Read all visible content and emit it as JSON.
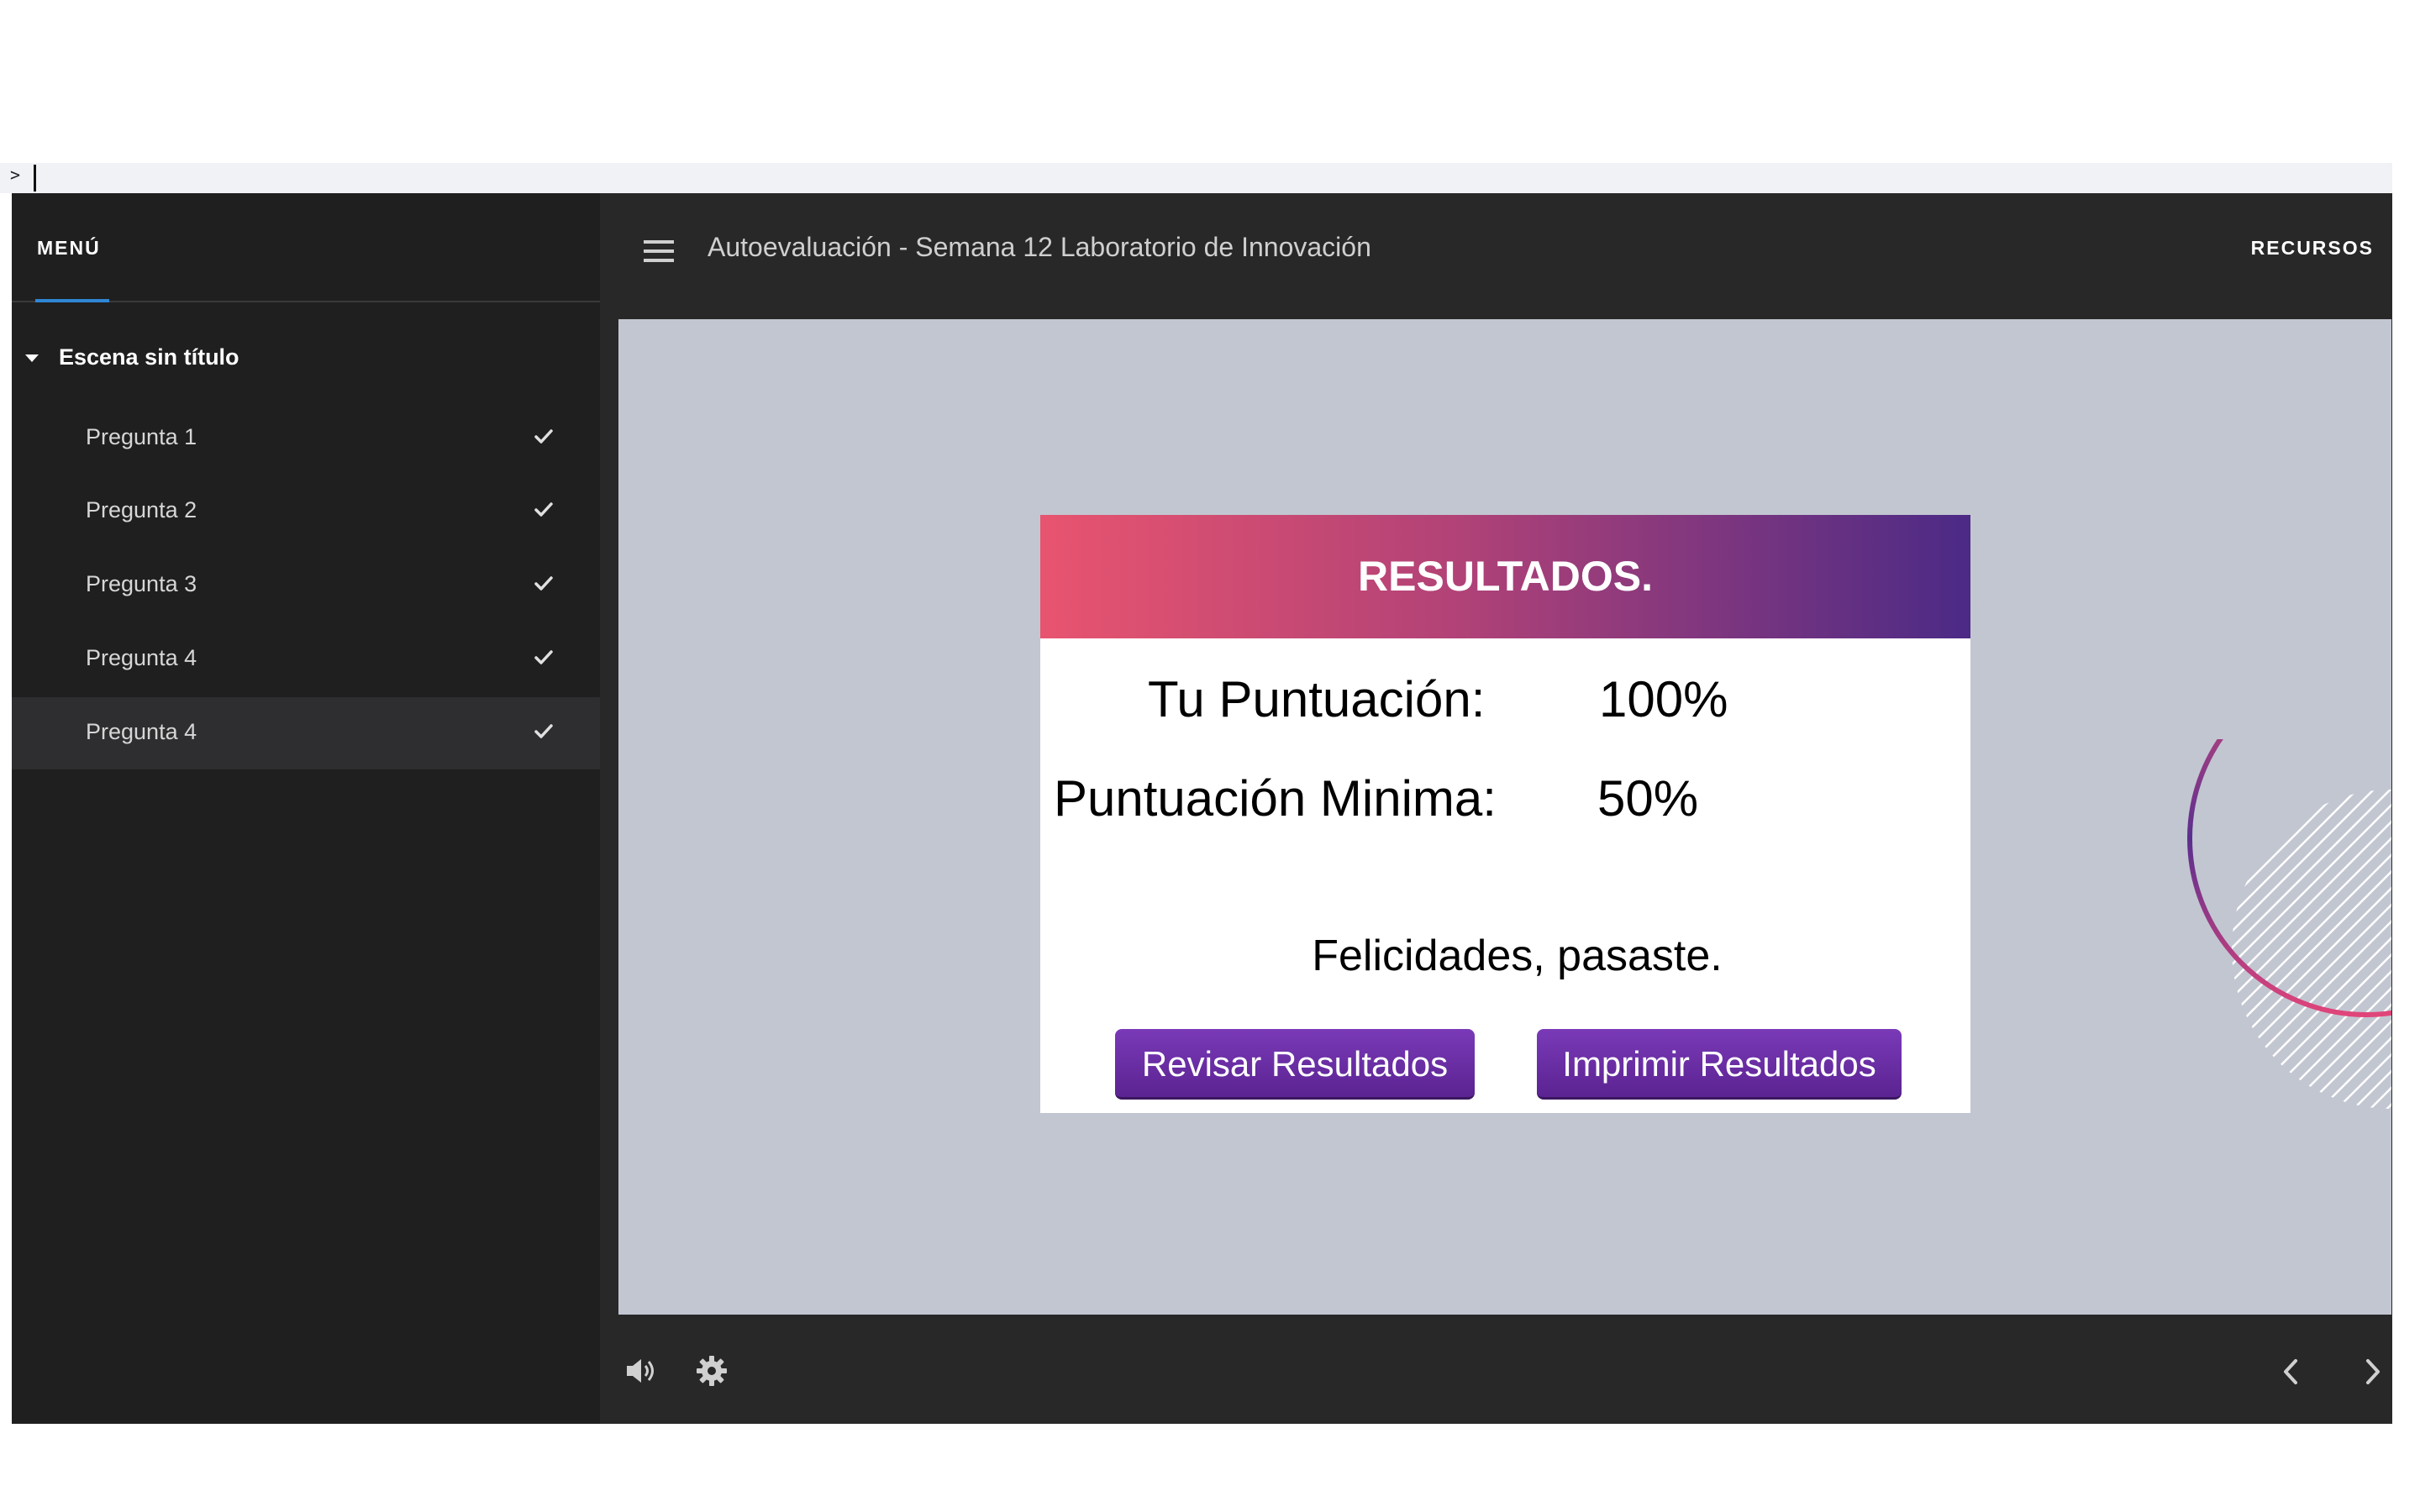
{
  "topbar": {
    "prompt": ">"
  },
  "sidebar": {
    "title": "MENÚ",
    "scene": "Escena sin título",
    "items": [
      {
        "label": "Pregunta 1",
        "status": "check-icon"
      },
      {
        "label": "Pregunta 2",
        "status": "check-icon"
      },
      {
        "label": "Pregunta 3",
        "status": "check-icon"
      },
      {
        "label": "Pregunta 4",
        "status": "check-icon"
      },
      {
        "label": "Pregunta 4",
        "status": "check-icon",
        "active": true
      }
    ]
  },
  "header": {
    "title": "Autoevaluación - Semana 12 Laboratorio de Innovación",
    "resources": "RECURSOS"
  },
  "results": {
    "title": "RESULTADOS.",
    "score_label": "Tu Puntuación:",
    "score_value": "100%",
    "min_label": "Puntuación Minima:",
    "min_value": "50%",
    "message": "Felicidades, pasaste.",
    "review_button": "Revisar Resultados",
    "print_button": "Imprimir Resultados"
  },
  "controls": {
    "audio": "volume-icon",
    "settings": "gear-icon",
    "prev": "chevron-left-icon",
    "next": "chevron-right-icon"
  },
  "colors": {
    "player_bg": "#282828",
    "sidebar_bg": "#1f1f1f",
    "slide_bg": "#c2c6d1",
    "accent_blue": "#2f86d4",
    "gradient_start": "#e8546f",
    "gradient_end": "#4b2a86",
    "button_purple": "#6a2fa6"
  }
}
